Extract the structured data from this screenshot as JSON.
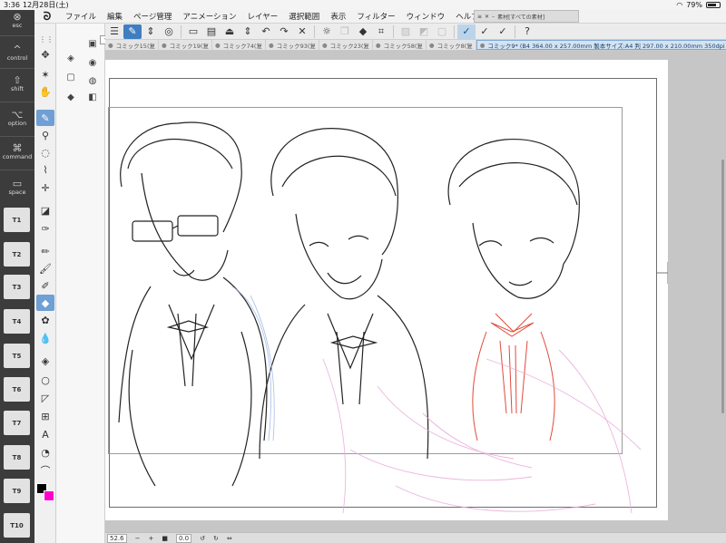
{
  "status": {
    "time": "3:36",
    "date": "12月28日(土)",
    "battery": "79%",
    "battery_level": 0.79,
    "wifi_icon": "wifi-icon"
  },
  "menubar": {
    "items": [
      "ファイル",
      "編集",
      "ページ管理",
      "アニメーション",
      "レイヤー",
      "選択範囲",
      "表示",
      "フィルター",
      "ウィンドウ",
      "ヘルプ"
    ]
  },
  "mini_palette": {
    "title": "素材[すべての素材]"
  },
  "tabs": [
    "コミック15(复",
    "コミック19(复",
    "コミック74(复",
    "コミック93(复",
    "コミック23(复",
    "コミック58(复",
    "コミック8(复",
    "コミック9* (B4 364.00 x 257.00mm 製本サイズ:A4 判 297.00 x 210.00mm 350dpi 52.6%)"
  ],
  "active_tab_index": 7,
  "keys": {
    "esc": "esc",
    "control": "control",
    "shift": "shift",
    "option": "option",
    "command": "command",
    "space": "space",
    "tkeys": [
      "T1",
      "T2",
      "T3",
      "T4",
      "T5",
      "T6",
      "T7",
      "T8",
      "T9",
      "T10"
    ]
  },
  "bottombar": {
    "zoom": "52.6",
    "rotation": "0.0"
  },
  "colors": {
    "main_color": "#000000",
    "sub_color": "#ff00cc",
    "accent": "#3f7ec0"
  },
  "icons": {
    "logo": "clip-studio-logo-icon",
    "menu": "hamburger-menu-icon",
    "undo": "undo-icon",
    "redo": "redo-icon",
    "new": "new-file-icon",
    "open": "open-folder-icon",
    "save": "save-icon",
    "fill": "fill-bucket-icon",
    "help": "help-icon"
  }
}
